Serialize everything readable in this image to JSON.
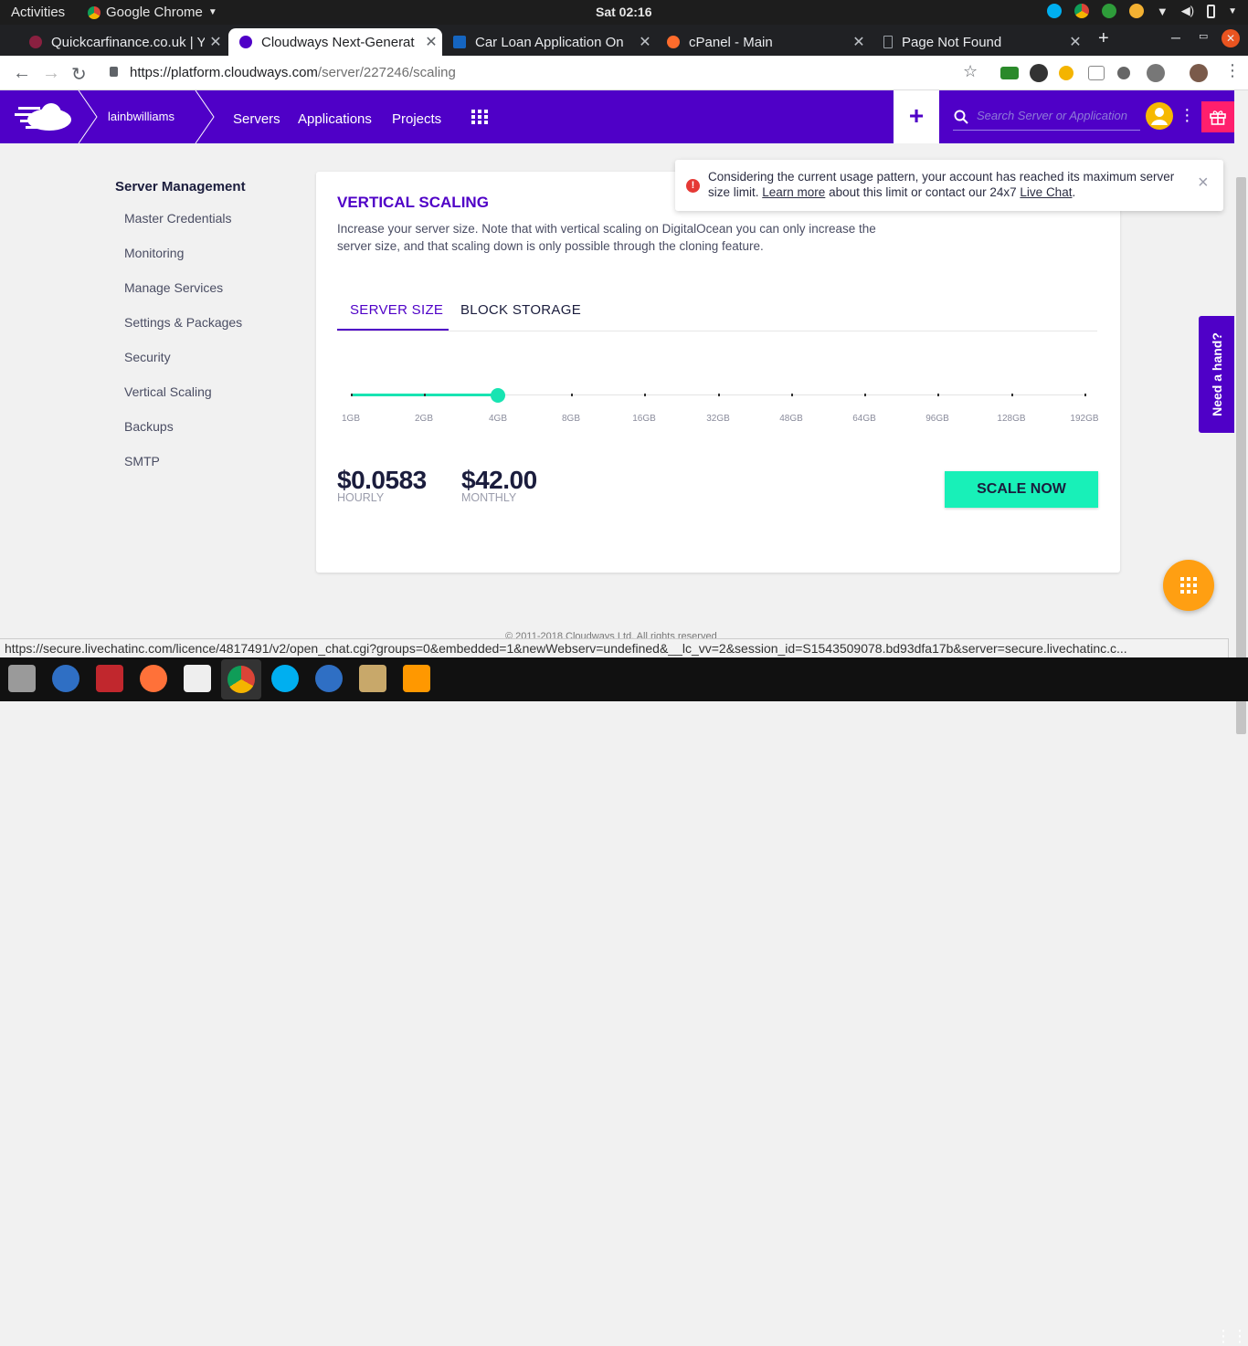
{
  "topbar": {
    "activities": "Activities",
    "app_name": "Google Chrome",
    "clock": "Sat 02:16"
  },
  "tabs": [
    {
      "title": "Quickcarfinance.co.uk | Y",
      "favicon_color": "#8a2040"
    },
    {
      "title": "Cloudways Next-Generat",
      "favicon_color": "#4f00c7"
    },
    {
      "title": "Car Loan Application On",
      "favicon_color": "#1565c0"
    },
    {
      "title": "cPanel - Main",
      "favicon_color": "#ff6c2c"
    },
    {
      "title": "Page Not Found",
      "favicon_color": "#9aa0a6"
    }
  ],
  "omnibox": {
    "url_host": "https://platform.cloudways.com",
    "url_path": "/server/227246/scaling"
  },
  "cwnav": {
    "username": "lainbwilliams",
    "links": [
      "Servers",
      "Applications",
      "Projects"
    ],
    "plus": "+",
    "search_placeholder": "Search Server or Application",
    "accent": "#4f00c7"
  },
  "sidebar": {
    "heading": "Server Management",
    "items": [
      "Master Credentials",
      "Monitoring",
      "Manage Services",
      "Settings & Packages",
      "Security",
      "Vertical Scaling",
      "Backups",
      "SMTP"
    ]
  },
  "card": {
    "title": "VERTICAL SCALING",
    "description": "Increase your server size. Note that with vertical scaling on DigitalOcean you can only increase the server size, and that scaling down is only possible through the cloning feature.",
    "tab_server_size": "SERVER SIZE",
    "tab_block_storage": "BLOCK STORAGE",
    "sizes": [
      "1GB",
      "2GB",
      "4GB",
      "8GB",
      "16GB",
      "32GB",
      "48GB",
      "64GB",
      "96GB",
      "128GB",
      "192GB"
    ],
    "selected_size_index": 2,
    "hourly_price": "$0.0583",
    "hourly_label": "HOURLY",
    "monthly_price": "$42.00",
    "monthly_label": "MONTHLY",
    "scale_button": "SCALE NOW"
  },
  "toast": {
    "msg_part1": "Considering the current usage pattern, your account has reached its maximum server size limit. ",
    "learn_more": "Learn more",
    "msg_part2": " about this limit or contact our 24x7 ",
    "live_chat": "Live Chat",
    "msg_end": ".",
    "close": "×"
  },
  "help_tab": "Need a hand?",
  "footer": "© 2011-2018 Cloudways Ltd. All rights reserved",
  "status_url": "https://secure.livechatinc.com/licence/4817491/v2/open_chat.cgi?groups=0&embedded=1&newWebserv=undefined&__lc_vv=2&session_id=S1543509078.bd93dfa17b&server=secure.livechatinc.c..."
}
